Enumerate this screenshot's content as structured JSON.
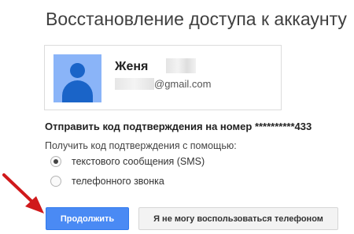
{
  "page": {
    "title": "Восстановление доступа к аккаунту"
  },
  "account": {
    "name": "Женя",
    "email_domain": "@gmail.com"
  },
  "verification": {
    "send_code_text": "Отправить код подтверждения на номер **********433",
    "method_label": "Получить код подтверждения с помощью:",
    "options": [
      {
        "label": "текстового сообщения (SMS)",
        "selected": true
      },
      {
        "label": "телефонного звонка",
        "selected": false
      }
    ]
  },
  "buttons": {
    "continue": "Продолжить",
    "no_phone": "Я не могу воспользоваться телефоном"
  },
  "colors": {
    "primary_button": "#4a8af4",
    "annotation_arrow": "#d0191b",
    "avatar_bg": "#8ab4f8",
    "avatar_figure": "#1a64c8"
  }
}
